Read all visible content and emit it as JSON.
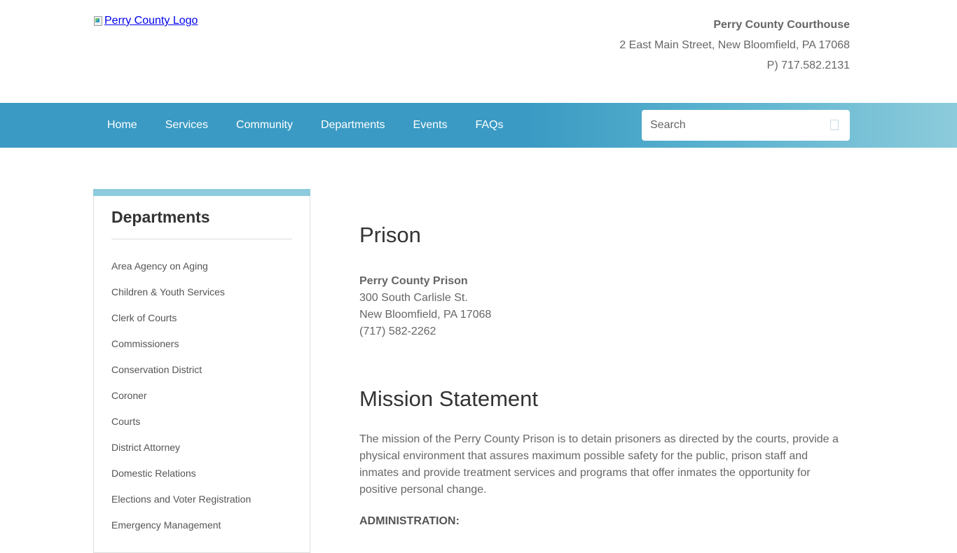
{
  "header": {
    "logo_alt": "Perry County Logo",
    "courthouse": "Perry County Courthouse",
    "address": "2 East Main Street, New Bloomfield, PA 17068",
    "phone": "P) 717.582.2131"
  },
  "nav": {
    "items": [
      "Home",
      "Services",
      "Community",
      "Departments",
      "Events",
      "FAQs"
    ],
    "search_placeholder": "Search",
    "search_icon": "search-icon"
  },
  "sidebar": {
    "title": "Departments",
    "items": [
      "Area Agency on Aging",
      "Children & Youth Services",
      "Clerk of Courts",
      "Commissioners",
      "Conservation District",
      "Coroner",
      "Courts",
      "District Attorney",
      "Domestic Relations",
      "Elections and Voter Registration",
      "Emergency Management"
    ]
  },
  "main": {
    "title": "Prison",
    "contact": {
      "name": "Perry County Prison",
      "street": "300 South Carlisle St.",
      "city": "New Bloomfield, PA 17068",
      "phone": "(717) 582-2262"
    },
    "mission_title": "Mission Statement",
    "mission_text": "The mission of the Perry County Prison is to detain prisoners as directed by the courts, provide a physical environment that assures maximum possible safety for the public, prison staff and inmates and provide treatment services and programs that offer inmates the opportunity for positive personal change.",
    "admin_heading": "ADMINISTRATION:"
  },
  "colors": {
    "nav_bg": "#3a9ac3",
    "nav_fade": "#8ccbdb",
    "sidebar_accent": "#8ccbdb"
  }
}
